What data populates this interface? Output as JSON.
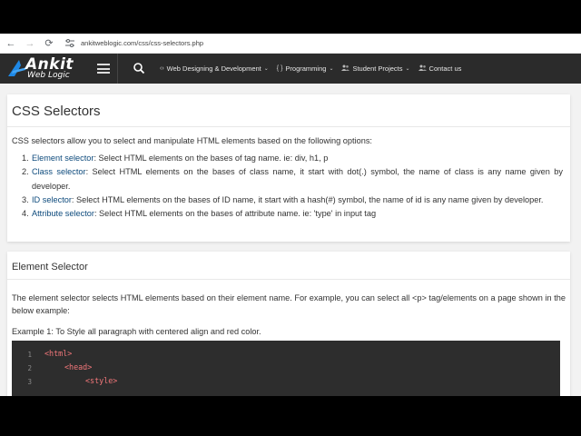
{
  "browser": {
    "url": "ankitweblogic.com/css/css-selectors.php"
  },
  "logo": {
    "main": "Ankit",
    "sub": "Web Logic"
  },
  "nav": {
    "items": [
      {
        "icon": "code-icon",
        "glyph": "‹›",
        "label": "Web Designing & Development"
      },
      {
        "icon": "braces-icon",
        "glyph": "{ }",
        "label": "Programming"
      },
      {
        "icon": "users-icon",
        "glyph": "👥",
        "label": "Student Projects"
      },
      {
        "icon": "contact-icon",
        "glyph": "👥",
        "label": "Contact us"
      }
    ]
  },
  "intro_card": {
    "title": "CSS Selectors",
    "intro": "CSS selectors allow you to select and manipulate HTML elements based on the following options:",
    "options": [
      {
        "num": "1.",
        "term": "Element selector",
        "text": ": Select HTML elements on the bases of tag name. ie: div, h1, p"
      },
      {
        "num": "2.",
        "term": "Class selector",
        "text": ": Select HTML elements on the bases of class name, it start with dot(.) symbol, the name of class is any name given by developer."
      },
      {
        "num": "3.",
        "term": "ID selector",
        "text": ": Select HTML elements on the bases of ID name, it start with a hash(#) symbol, the name of id is any name given by developer."
      },
      {
        "num": "4.",
        "term": "Attribute selector",
        "text": ": Select HTML elements on the bases of attribute name. ie: 'type' in input tag"
      }
    ]
  },
  "element_card": {
    "title": "Element Selector",
    "description": "The element selector selects HTML elements based on their element name. For example, you can select all <p> tag/elements on a page shown in the below example:",
    "example": "Example 1: To Style all paragraph with centered align and red color.",
    "code_lines": [
      {
        "n": "1",
        "code": "<html>"
      },
      {
        "n": "2",
        "code": "<head>"
      },
      {
        "n": "3",
        "code": "<style>"
      }
    ]
  },
  "colors": {
    "nav_bg": "#2b2b2b",
    "term": "#0d4a7c",
    "code_bg": "#2d2d2d",
    "code_tag": "#f2777a"
  }
}
